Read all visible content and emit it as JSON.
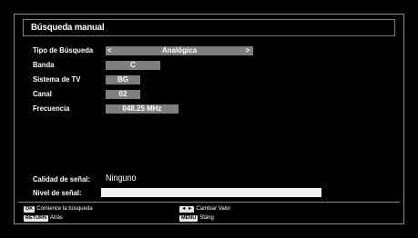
{
  "panel": {
    "title": "Búsqueda manual"
  },
  "fields": {
    "tipo": {
      "label": "Tipo de Búsqueda",
      "value": "Analógica",
      "arrow_left": "<",
      "arrow_right": ">"
    },
    "banda": {
      "label": "Banda",
      "value": "C"
    },
    "sistema": {
      "label": "Sistema de TV",
      "value": "BG"
    },
    "canal": {
      "label": "Canal",
      "value": "02"
    },
    "frecuencia": {
      "label": "Frecuencia",
      "value": "048.25 MHz"
    }
  },
  "signal": {
    "quality_label": "Calidad de señal:",
    "quality_value": "Ninguno",
    "level_label": "Nivel de señal:"
  },
  "hints": {
    "ok_key": "OK",
    "ok_text": "Comience la búsqueda",
    "return_key": "RETURN",
    "return_text": "Atrás",
    "arrows_key": "◄ ►",
    "arrows_text": "Cambiar Valor",
    "menu_key": "MENU",
    "menu_text": "Stäng"
  },
  "colors": {
    "background": "#000000",
    "field_gray": "#7f7f7f",
    "border_gray": "#8a8a8a"
  }
}
